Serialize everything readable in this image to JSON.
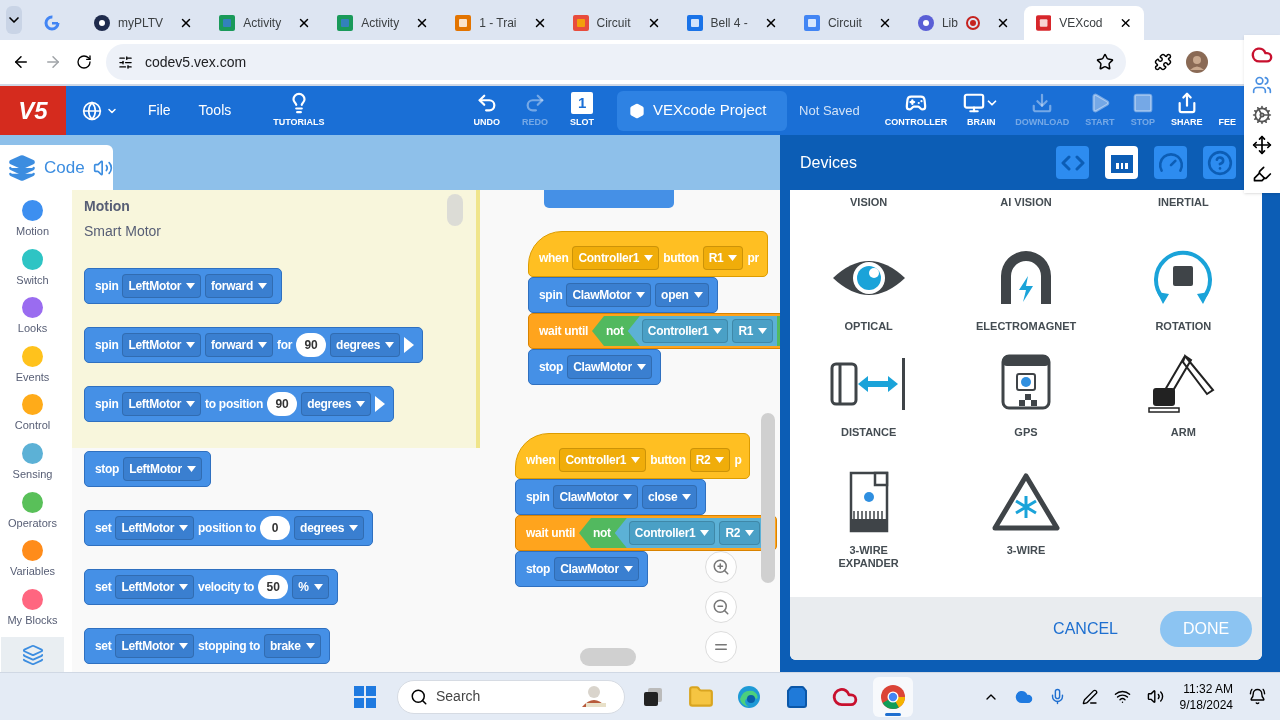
{
  "browser": {
    "tabs": [
      {
        "kind": "google",
        "selected": false,
        "recording": false
      },
      {
        "kind": "pltw",
        "title": "myPLTV",
        "selected": false,
        "recording": false
      },
      {
        "kind": "activity",
        "title": "Activity",
        "selected": false,
        "recording": false
      },
      {
        "kind": "activity",
        "title": "Activity",
        "selected": false,
        "recording": false
      },
      {
        "kind": "classroom",
        "title": "1 - Trai",
        "selected": false,
        "recording": false
      },
      {
        "kind": "grid",
        "title": "Circuit",
        "selected": false,
        "recording": false
      },
      {
        "kind": "person",
        "title": "Bell 4 -",
        "selected": false,
        "recording": false
      },
      {
        "kind": "doc",
        "title": "Circuit",
        "selected": false,
        "recording": false
      },
      {
        "kind": "lib",
        "title": "Lib",
        "selected": false,
        "recording": true
      },
      {
        "kind": "vex",
        "title": "VEXcod",
        "selected": true,
        "recording": false
      }
    ],
    "url": "codev5.vex.com"
  },
  "toolbar": {
    "logo": "V5",
    "menus": [
      "File",
      "Tools"
    ],
    "left_buttons": [
      {
        "kind": "tutorials",
        "label": "TUTORIALS",
        "disabled": false
      },
      {
        "kind": "undo",
        "label": "UNDO",
        "disabled": false
      },
      {
        "kind": "redo",
        "label": "REDO",
        "disabled": true
      },
      {
        "kind": "slot",
        "label": "SLOT",
        "disabled": false,
        "slot": "1"
      }
    ],
    "project": "VEXcode Project",
    "save_status": "Not Saved",
    "right_buttons": [
      {
        "kind": "controller",
        "label": "CONTROLLER",
        "disabled": false
      },
      {
        "kind": "brain",
        "label": "BRAIN",
        "disabled": false
      },
      {
        "kind": "download",
        "label": "DOWNLOAD",
        "disabled": true
      },
      {
        "kind": "start",
        "label": "START",
        "disabled": true
      },
      {
        "kind": "stop",
        "label": "STOP",
        "disabled": true
      },
      {
        "kind": "share",
        "label": "SHARE",
        "disabled": false
      },
      {
        "kind": "feedback",
        "label": "FEE",
        "disabled": false
      }
    ]
  },
  "code_tab": {
    "label": "Code"
  },
  "categories": [
    {
      "name": "Motion",
      "color": "#3d8ff0"
    },
    {
      "name": "Switch",
      "color": "#2ec4c4"
    },
    {
      "name": "Looks",
      "color": "#9a6cf0"
    },
    {
      "name": "Events",
      "color": "#ffc21c"
    },
    {
      "name": "Control",
      "color": "#ffab19"
    },
    {
      "name": "Sensing",
      "color": "#5cb1d6"
    },
    {
      "name": "Operators",
      "color": "#59c059"
    },
    {
      "name": "Variables",
      "color": "#ff8c1a"
    },
    {
      "name": "My Blocks",
      "color": "#ff6680"
    }
  ],
  "palette": {
    "heading": "Motion",
    "subheading": "Smart Motor",
    "blocks": [
      {
        "run_arrow": false,
        "parts": [
          {
            "kind": "label",
            "text": "spin"
          },
          {
            "kind": "dropdown",
            "text": "LeftMotor"
          },
          {
            "kind": "dropdown",
            "text": "forward"
          }
        ]
      },
      {
        "run_arrow": true,
        "parts": [
          {
            "kind": "label",
            "text": "spin"
          },
          {
            "kind": "dropdown",
            "text": "LeftMotor"
          },
          {
            "kind": "dropdown",
            "text": "forward"
          },
          {
            "kind": "label",
            "text": "for"
          },
          {
            "kind": "number",
            "text": "90"
          },
          {
            "kind": "dropdown",
            "text": "degrees"
          }
        ]
      },
      {
        "run_arrow": true,
        "parts": [
          {
            "kind": "label",
            "text": "spin"
          },
          {
            "kind": "dropdown",
            "text": "LeftMotor"
          },
          {
            "kind": "label",
            "text": "to position"
          },
          {
            "kind": "number",
            "text": "90"
          },
          {
            "kind": "dropdown",
            "text": "degrees"
          }
        ]
      },
      {
        "run_arrow": false,
        "parts": [
          {
            "kind": "label",
            "text": "stop"
          },
          {
            "kind": "dropdown",
            "text": "LeftMotor"
          }
        ]
      },
      {
        "run_arrow": false,
        "parts": [
          {
            "kind": "label",
            "text": "set"
          },
          {
            "kind": "dropdown",
            "text": "LeftMotor"
          },
          {
            "kind": "label",
            "text": "position to"
          },
          {
            "kind": "number",
            "text": "0"
          },
          {
            "kind": "dropdown",
            "text": "degrees"
          }
        ]
      },
      {
        "run_arrow": false,
        "parts": [
          {
            "kind": "label",
            "text": "set"
          },
          {
            "kind": "dropdown",
            "text": "LeftMotor"
          },
          {
            "kind": "label",
            "text": "velocity to"
          },
          {
            "kind": "number",
            "text": "50"
          },
          {
            "kind": "dropdown",
            "text": "%"
          }
        ]
      },
      {
        "run_arrow": false,
        "parts": [
          {
            "kind": "label",
            "text": "set"
          },
          {
            "kind": "dropdown",
            "text": "LeftMotor"
          },
          {
            "kind": "label",
            "text": "stopping to"
          },
          {
            "kind": "dropdown",
            "text": "brake"
          }
        ]
      }
    ]
  },
  "workspace": {
    "stacks": [
      {
        "blocks": [
          {
            "kind": "motion"
          }
        ]
      },
      {
        "blocks": [
          {
            "kind": "hat",
            "parts": [
              {
                "kind": "label",
                "text": "when"
              },
              {
                "kind": "dropdown",
                "text": "Controller1"
              },
              {
                "kind": "label",
                "text": "button"
              },
              {
                "kind": "dropdown",
                "text": "R1"
              },
              {
                "kind": "label",
                "text": "pr"
              }
            ]
          },
          {
            "kind": "motion",
            "parts": [
              {
                "kind": "label",
                "text": "spin"
              },
              {
                "kind": "dropdown",
                "text": "ClawMotor"
              },
              {
                "kind": "dropdown",
                "text": "open"
              }
            ]
          },
          {
            "kind": "control",
            "parts": [
              {
                "kind": "label",
                "text": "wait until"
              },
              {
                "kind": "operator_boolean",
                "parts": [
                  {
                    "kind": "label",
                    "text": "not"
                  },
                  {
                    "kind": "sensing_boolean",
                    "parts": [
                      {
                        "kind": "dropdown",
                        "text": "Controller1"
                      },
                      {
                        "kind": "dropdown",
                        "text": "R1"
                      }
                    ]
                  }
                ]
              }
            ]
          },
          {
            "kind": "motion",
            "parts": [
              {
                "kind": "label",
                "text": "stop"
              },
              {
                "kind": "dropdown",
                "text": "ClawMotor"
              }
            ]
          }
        ]
      },
      {
        "blocks": [
          {
            "kind": "hat",
            "parts": [
              {
                "kind": "label",
                "text": "when"
              },
              {
                "kind": "dropdown",
                "text": "Controller1"
              },
              {
                "kind": "label",
                "text": "button"
              },
              {
                "kind": "dropdown",
                "text": "R2"
              },
              {
                "kind": "label",
                "text": "p"
              }
            ]
          },
          {
            "kind": "motion",
            "parts": [
              {
                "kind": "label",
                "text": "spin"
              },
              {
                "kind": "dropdown",
                "text": "ClawMotor"
              },
              {
                "kind": "dropdown",
                "text": "close"
              }
            ]
          },
          {
            "kind": "control",
            "parts": [
              {
                "kind": "label",
                "text": "wait until"
              },
              {
                "kind": "operator_boolean",
                "parts": [
                  {
                    "kind": "label",
                    "text": "not"
                  },
                  {
                    "kind": "sensing_boolean",
                    "parts": [
                      {
                        "kind": "dropdown",
                        "text": "Controller1"
                      },
                      {
                        "kind": "dropdown",
                        "text": "R2"
                      }
                    ]
                  }
                ]
              }
            ]
          },
          {
            "kind": "motion",
            "parts": [
              {
                "kind": "label",
                "text": "stop"
              },
              {
                "kind": "dropdown",
                "text": "ClawMotor"
              }
            ]
          }
        ]
      }
    ]
  },
  "devices_panel": {
    "title": "Devices",
    "tabs": [
      {
        "kind": "code",
        "selected": false
      },
      {
        "kind": "ports",
        "selected": true
      },
      {
        "kind": "dashboard",
        "selected": false
      },
      {
        "kind": "help",
        "selected": false
      }
    ],
    "devices": [
      {
        "kind": "vision",
        "label": "VISION"
      },
      {
        "kind": "ai_vision",
        "label": "AI VISION"
      },
      {
        "kind": "inertial",
        "label": "INERTIAL"
      },
      {
        "kind": "optical",
        "label": "OPTICAL"
      },
      {
        "kind": "electromagnet",
        "label": "ELECTROMAGNET"
      },
      {
        "kind": "rotation",
        "label": "ROTATION"
      },
      {
        "kind": "distance",
        "label": "DISTANCE"
      },
      {
        "kind": "gps",
        "label": "GPS"
      },
      {
        "kind": "arm",
        "label": "ARM"
      },
      {
        "kind": "expander",
        "label": "3-WIRE EXPANDER"
      },
      {
        "kind": "threewire",
        "label": "3-WIRE"
      }
    ],
    "cancel": "CANCEL",
    "done": "DONE",
    "done_disabled": true
  },
  "taskbar": {
    "search": "Search",
    "apps": [
      {
        "kind": "taskview",
        "selected": false
      },
      {
        "kind": "files",
        "selected": false
      },
      {
        "kind": "edge",
        "selected": false
      },
      {
        "kind": "store",
        "selected": false
      },
      {
        "kind": "my",
        "selected": false
      },
      {
        "kind": "chrome",
        "selected": true
      }
    ],
    "time": "11:32 AM",
    "date": "9/18/2024"
  }
}
